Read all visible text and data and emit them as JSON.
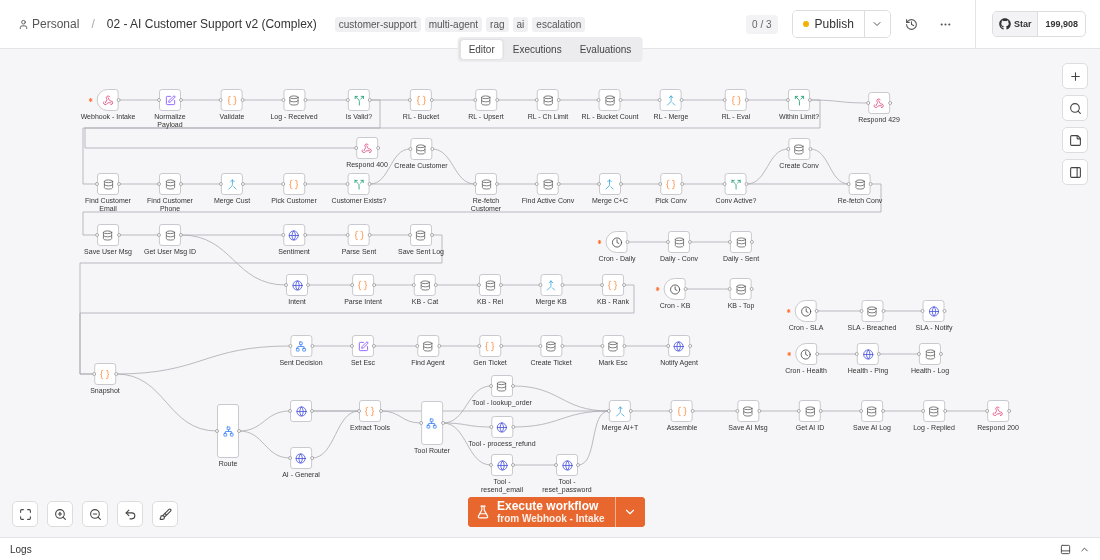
{
  "breadcrumb": {
    "owner": "Personal",
    "separator": "/",
    "title": "02 - AI Customer Support v2 (Complex)"
  },
  "tags": [
    "customer-support",
    "multi-agent",
    "rag",
    "ai",
    "escalation"
  ],
  "counter": "0 / 3",
  "publish": {
    "label": "Publish"
  },
  "github": {
    "label": "Star",
    "count": "199,908"
  },
  "tabs": [
    {
      "label": "Editor",
      "selected": true
    },
    {
      "label": "Executions",
      "selected": false
    },
    {
      "label": "Evaluations",
      "selected": false
    }
  ],
  "nodes": [
    {
      "label": "Webhook - Intake",
      "kind": "webhook-trigger"
    },
    {
      "label": "Normalize Payload",
      "kind": "edit"
    },
    {
      "label": "Validate",
      "kind": "code"
    },
    {
      "label": "Log - Received",
      "kind": "db"
    },
    {
      "label": "Is Valid?",
      "kind": "if"
    },
    {
      "label": "RL - Bucket",
      "kind": "code"
    },
    {
      "label": "RL - Upsert",
      "kind": "db"
    },
    {
      "label": "RL - Ch Limit",
      "kind": "db"
    },
    {
      "label": "RL - Bucket Count",
      "kind": "db"
    },
    {
      "label": "RL - Merge",
      "kind": "merge"
    },
    {
      "label": "RL - Eval",
      "kind": "code"
    },
    {
      "label": "Within Limit?",
      "kind": "if"
    },
    {
      "label": "Respond 429",
      "kind": "respond"
    },
    {
      "label": "Respond 400",
      "kind": "respond"
    },
    {
      "label": "Create Customer",
      "kind": "db"
    },
    {
      "label": "Find Customer Email",
      "kind": "db"
    },
    {
      "label": "Find Customer Phone",
      "kind": "db"
    },
    {
      "label": "Merge Cust",
      "kind": "merge"
    },
    {
      "label": "Pick Customer",
      "kind": "code"
    },
    {
      "label": "Customer Exists?",
      "kind": "if"
    },
    {
      "label": "Re-fetch Customer",
      "kind": "db"
    },
    {
      "label": "Find Active Conv",
      "kind": "db"
    },
    {
      "label": "Merge C+C",
      "kind": "merge"
    },
    {
      "label": "Pick Conv",
      "kind": "code"
    },
    {
      "label": "Conv Active?",
      "kind": "if"
    },
    {
      "label": "Create Conv",
      "kind": "db"
    },
    {
      "label": "Re-fetch Conv",
      "kind": "db"
    },
    {
      "label": "Save User Msg",
      "kind": "db"
    },
    {
      "label": "Get User Msg ID",
      "kind": "db"
    },
    {
      "label": "Sentiment",
      "kind": "http"
    },
    {
      "label": "Parse Sent",
      "kind": "code"
    },
    {
      "label": "Save Sent Log",
      "kind": "db"
    },
    {
      "label": "Cron - Daily",
      "kind": "cron"
    },
    {
      "label": "Daily - Conv",
      "kind": "db"
    },
    {
      "label": "Daily - Sent",
      "kind": "db"
    },
    {
      "label": "Intent",
      "kind": "http"
    },
    {
      "label": "Parse Intent",
      "kind": "code"
    },
    {
      "label": "KB - Cat",
      "kind": "db"
    },
    {
      "label": "KB - Rel",
      "kind": "db"
    },
    {
      "label": "Merge KB",
      "kind": "merge"
    },
    {
      "label": "KB - Rank",
      "kind": "code"
    },
    {
      "label": "Cron - KB",
      "kind": "cron"
    },
    {
      "label": "KB - Top",
      "kind": "db"
    },
    {
      "label": "Cron - SLA",
      "kind": "cron"
    },
    {
      "label": "SLA - Breached",
      "kind": "db"
    },
    {
      "label": "SLA - Notify",
      "kind": "http"
    },
    {
      "label": "Cron - Health",
      "kind": "cron"
    },
    {
      "label": "Health - Ping",
      "kind": "http"
    },
    {
      "label": "Health - Log",
      "kind": "db"
    },
    {
      "label": "Sent Decision",
      "kind": "switch"
    },
    {
      "label": "Set Esc",
      "kind": "edit"
    },
    {
      "label": "Find Agent",
      "kind": "db"
    },
    {
      "label": "Gen Ticket",
      "kind": "code"
    },
    {
      "label": "Create Ticket",
      "kind": "db"
    },
    {
      "label": "Mark Esc",
      "kind": "db"
    },
    {
      "label": "Notify Agent",
      "kind": "http"
    },
    {
      "label": "Snapshot",
      "kind": "code"
    },
    {
      "label": "Route",
      "kind": "switch"
    },
    {
      "kind": "http"
    },
    {
      "label": "AI - General",
      "kind": "http"
    },
    {
      "label": "Extract Tools",
      "kind": "code"
    },
    {
      "label": "Tool Router",
      "kind": "switch"
    },
    {
      "label": "Tool - lookup_order",
      "kind": "db"
    },
    {
      "label": "Tool - process_refund",
      "kind": "http"
    },
    {
      "label": "Tool - resend_email",
      "kind": "http"
    },
    {
      "label": "Tool - reset_password",
      "kind": "http"
    },
    {
      "label": "Merge AI+T",
      "kind": "merge"
    },
    {
      "label": "Assemble",
      "kind": "code"
    },
    {
      "label": "Save AI Msg",
      "kind": "db"
    },
    {
      "label": "Get AI ID",
      "kind": "db"
    },
    {
      "label": "Save AI Log",
      "kind": "db"
    },
    {
      "label": "Log - Replied",
      "kind": "db"
    },
    {
      "label": "Respond 200",
      "kind": "respond"
    }
  ],
  "execute": {
    "label": "Execute workflow",
    "sublabel": "from Webhook - Intake"
  },
  "logs": {
    "label": "Logs"
  }
}
